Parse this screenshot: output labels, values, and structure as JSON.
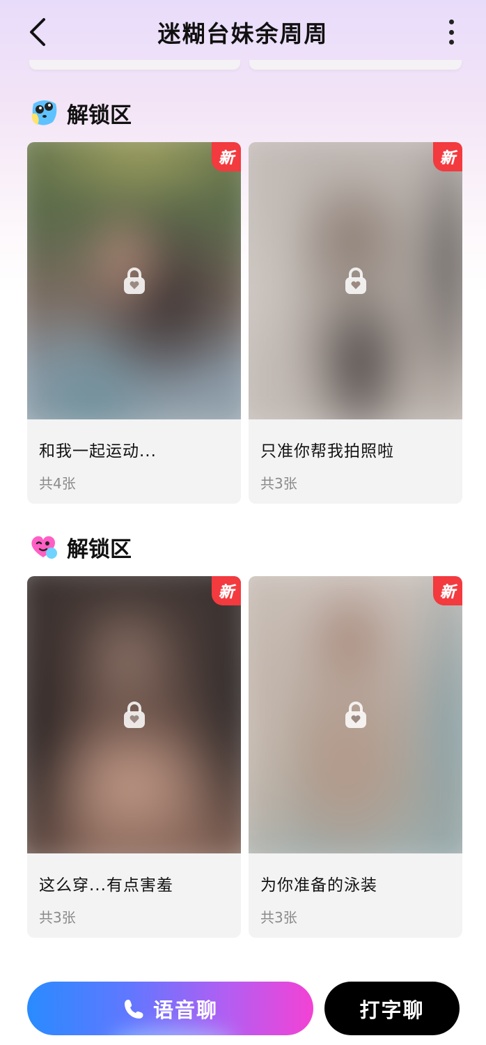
{
  "header": {
    "title": "迷糊台妹余周周",
    "back_icon": "chevron-left-icon",
    "more_icon": "more-vertical-icon"
  },
  "sections": [
    {
      "title": "解锁区",
      "icon": "cute-face-emoji-icon",
      "cards": [
        {
          "caption": "和我一起运动...",
          "count": "共4张",
          "badge": "新"
        },
        {
          "caption": "只准你帮我拍照啦",
          "count": "共3张",
          "badge": "新"
        }
      ]
    },
    {
      "title": "解锁区",
      "icon": "winking-heart-emoji-icon",
      "cards": [
        {
          "caption": "这么穿...有点害羞",
          "count": "共3张",
          "badge": "新"
        },
        {
          "caption": "为你准备的泳装",
          "count": "共3张",
          "badge": "新"
        }
      ]
    }
  ],
  "bottom_bar": {
    "voice_chat_label": "语音聊",
    "voice_icon": "phone-icon",
    "text_chat_label": "打字聊"
  },
  "colors": {
    "badge_red": "#f23a3f",
    "voice_gradient_start": "#2a8bff",
    "voice_gradient_end": "#f342d4",
    "text_button": "#000000"
  }
}
